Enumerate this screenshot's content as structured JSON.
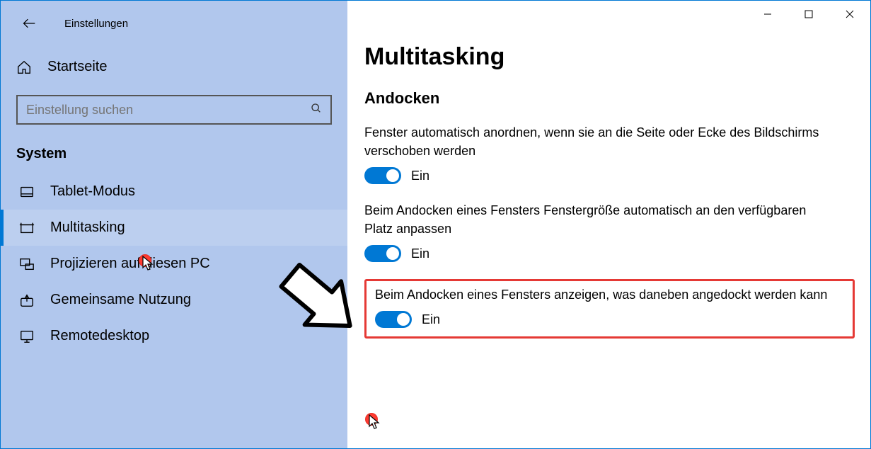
{
  "window": {
    "title": "Einstellungen"
  },
  "sidebar": {
    "home": "Startseite",
    "search_placeholder": "Einstellung suchen",
    "category": "System",
    "items": [
      {
        "label": "Tablet-Modus",
        "icon": "tablet-icon"
      },
      {
        "label": "Multitasking",
        "icon": "multitasking-icon",
        "selected": true
      },
      {
        "label": "Projizieren auf diesen PC",
        "icon": "project-icon"
      },
      {
        "label": "Gemeinsame Nutzung",
        "icon": "shared-icon"
      },
      {
        "label": "Remotedesktop",
        "icon": "remote-icon"
      }
    ]
  },
  "main": {
    "title": "Multitasking",
    "section": "Andocken",
    "settings": [
      {
        "label": "Fenster automatisch anordnen, wenn sie an die Seite oder Ecke des Bildschirms verschoben werden",
        "state": "Ein",
        "on": true
      },
      {
        "label": "Beim Andocken eines Fensters Fenstergröße automatisch an den verfügbaren Platz anpassen",
        "state": "Ein",
        "on": true
      },
      {
        "label": "Beim Andocken eines Fensters anzeigen, was daneben angedockt werden kann",
        "state": "Ein",
        "on": true,
        "highlighted": true
      }
    ]
  }
}
